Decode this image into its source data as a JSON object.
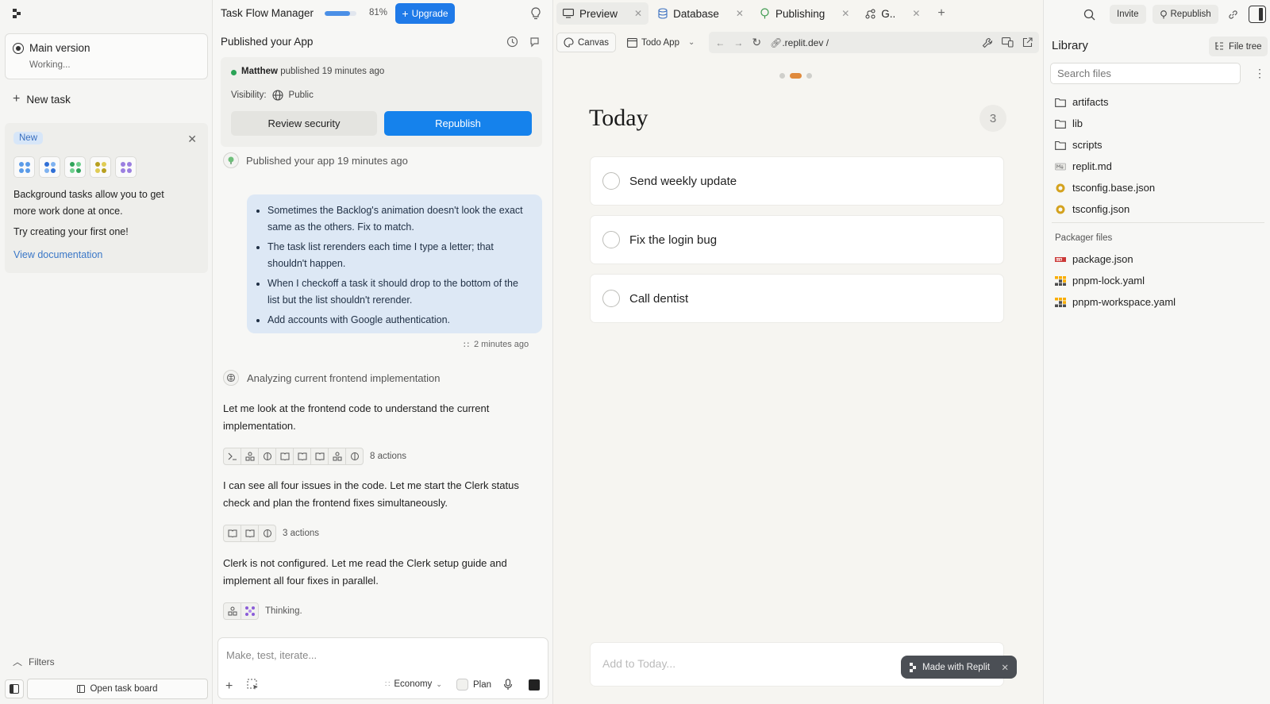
{
  "sidebar": {
    "main_version": {
      "title": "Main version",
      "status": "Working..."
    },
    "new_task_label": "New task",
    "promo": {
      "badge": "New",
      "text": "Background tasks allow you to get more work done at once.",
      "try_text": "Try creating your first one!",
      "link": "View documentation"
    },
    "filters_label": "Filters",
    "task_board_label": "Open task board"
  },
  "chat": {
    "app_title": "Task Flow Manager",
    "progress_percent": 81,
    "progress_label": "81%",
    "upgrade_label": "Upgrade",
    "published_header": "Published your App",
    "publish_card": {
      "author": "Matthew",
      "published_text": "published 19 minutes ago",
      "visibility_label": "Visibility:",
      "visibility_value": "Public",
      "review_label": "Review security",
      "republish_label": "Republish"
    },
    "published_line": "Published your app 19 minutes ago",
    "user_message": [
      "Sometimes the Backlog's animation doesn't look the exact same as the others. Fix to match.",
      "The task list rerenders each time I type a letter; that shouldn't happen.",
      "When I checkoff a task it should drop to the bottom of the list but the list shouldn't rerender.",
      "Add accounts with Google authentication."
    ],
    "message_time": "2 minutes ago",
    "analyzing": "Analyzing current frontend implementation",
    "para1": "Let me look at the frontend code to understand the current implementation.",
    "actions1_label": "8 actions",
    "para2": "I can see all four issues in the code. Let me start the Clerk status check and plan the frontend fixes simultaneously.",
    "actions2_label": "3 actions",
    "para3": "Clerk is not configured. Let me read the Clerk setup guide and implement all four fixes in parallel.",
    "thinking_label": "Thinking.",
    "composer": {
      "placeholder": "Make, test, iterate...",
      "mode": "Economy",
      "plan_label": "Plan"
    }
  },
  "preview": {
    "tabs": [
      {
        "label": "Preview",
        "icon": "monitor-icon"
      },
      {
        "label": "Database",
        "icon": "database-icon"
      },
      {
        "label": "Publishing",
        "icon": "publishing-icon"
      },
      {
        "label": "G..",
        "icon": "git-icon"
      }
    ],
    "canvas_label": "Canvas",
    "app_select": "Todo App",
    "url": ".replit.dev /",
    "app": {
      "title": "Today",
      "count": "3",
      "todos": [
        "Send weekly update",
        "Fix the login bug",
        "Call dentist"
      ],
      "add_placeholder": "Add to Today...",
      "made_with": "Made with Replit"
    }
  },
  "topright": {
    "invite_label": "Invite",
    "republish_label": "Republish"
  },
  "library": {
    "title": "Library",
    "file_tree_label": "File tree",
    "search_placeholder": "Search files",
    "files": [
      {
        "name": "artifacts",
        "icon": "folder-icon"
      },
      {
        "name": "lib",
        "icon": "folder-icon"
      },
      {
        "name": "scripts",
        "icon": "folder-icon"
      },
      {
        "name": "replit.md",
        "icon": "markdown-icon"
      },
      {
        "name": "tsconfig.base.json",
        "icon": "json-icon"
      },
      {
        "name": "tsconfig.json",
        "icon": "json-icon"
      }
    ],
    "packager_heading": "Packager files",
    "packager_files": [
      {
        "name": "package.json",
        "icon": "npm-icon"
      },
      {
        "name": "pnpm-lock.yaml",
        "icon": "pnpm-icon"
      },
      {
        "name": "pnpm-workspace.yaml",
        "icon": "pnpm-icon"
      }
    ]
  },
  "colors": {
    "accent_blue": "#1582ec",
    "upgrade_blue": "#1f7ae8",
    "bubble_blue": "#dde8f5",
    "published_green": "#2aa356",
    "carousel_orange": "#e08a3c"
  }
}
